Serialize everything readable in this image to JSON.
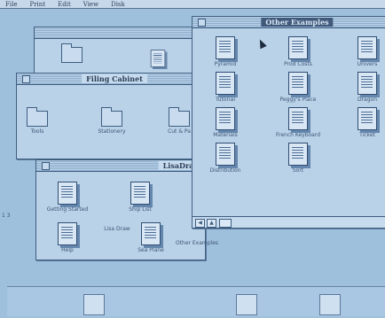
{
  "menubar": {
    "items": [
      "File",
      "Print",
      "Edit",
      "View",
      "Disk"
    ]
  },
  "windows": {
    "filing_cabinet": {
      "title": "Filing Cabinet",
      "icons": [
        "Tools",
        "Stationery",
        "Cut & Pa"
      ]
    },
    "lisadraw": {
      "title": "LisaDra",
      "icons": [
        "Getting Started",
        "Ship List",
        "Help",
        "Lisa Draw",
        "Sea Plane",
        "Other Examples"
      ]
    },
    "other_examples": {
      "title": "Other Examples",
      "icons": [
        [
          "Pyramid",
          "Prod Costs",
          "Univers"
        ],
        [
          "Tutorial",
          "Peggy's Place",
          "Dragon"
        ],
        [
          "Materials",
          "French Keyboard",
          "Ticket"
        ],
        [
          "Distribution",
          "Sort",
          ""
        ]
      ]
    }
  },
  "colors": {
    "desktop": "#9fc0dc",
    "window": "#b9d2e8",
    "border": "#3e5d80"
  }
}
